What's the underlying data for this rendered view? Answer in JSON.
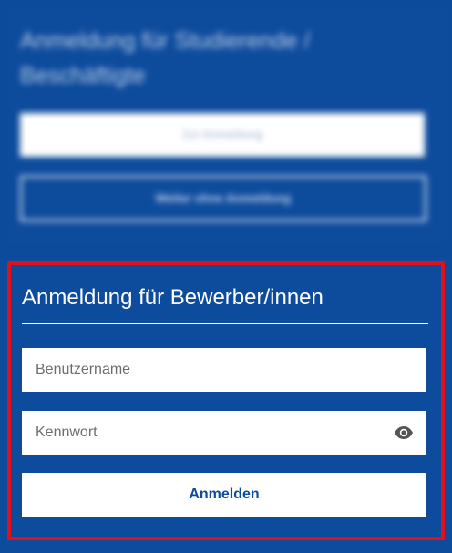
{
  "blurred_section": {
    "title": "Anmeldung für Studierende / Beschäftigte",
    "primary_button_label": "Zur Anmeldung",
    "secondary_button_label": "Weiter ohne Anmeldung"
  },
  "applicant_login": {
    "title": "Anmeldung für Bewerber/innen",
    "username_placeholder": "Benutzername",
    "password_placeholder": "Kennwort",
    "password_toggle_icon": "eye-icon",
    "submit_label": "Anmelden"
  },
  "colors": {
    "background": "#0d4b9c",
    "highlight_frame": "#e3101b",
    "button_text": "#0d4b9c"
  }
}
